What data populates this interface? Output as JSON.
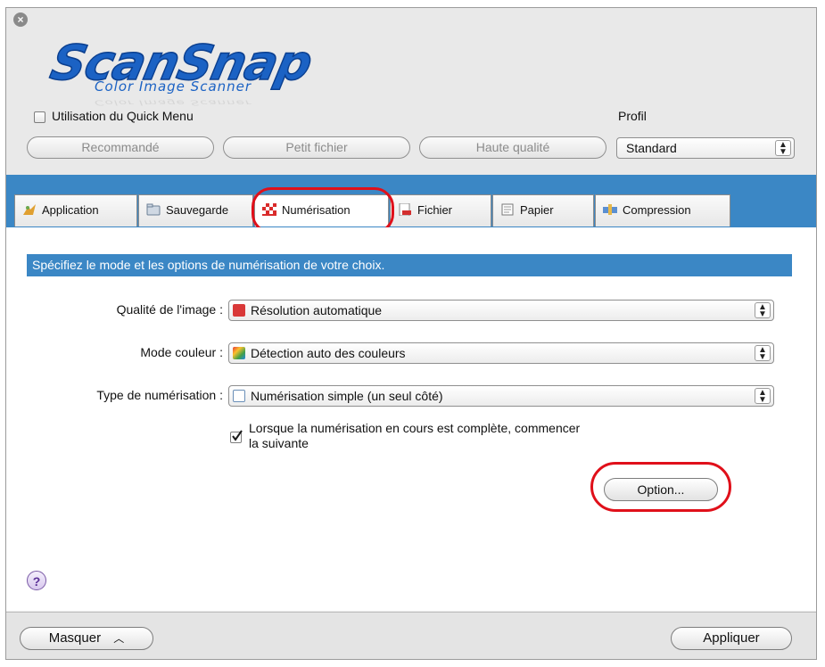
{
  "header": {
    "logo_main": "ScanSnap",
    "logo_sub": "Color Image Scanner"
  },
  "quick_menu": {
    "label": "Utilisation du Quick Menu",
    "checked": false
  },
  "profile_buttons": [
    "Recommandé",
    "Petit fichier",
    "Haute qualité"
  ],
  "profile": {
    "label": "Profil",
    "value": "Standard"
  },
  "tabs": [
    {
      "label": "Application",
      "icon": "application-icon"
    },
    {
      "label": "Sauvegarde",
      "icon": "folder-icon"
    },
    {
      "label": "Numérisation",
      "icon": "scan-icon",
      "selected": true
    },
    {
      "label": "Fichier",
      "icon": "pdf-file-icon"
    },
    {
      "label": "Papier",
      "icon": "paper-icon"
    },
    {
      "label": "Compression",
      "icon": "compression-icon"
    }
  ],
  "scan_panel": {
    "heading": "Spécifiez le mode et les options de numérisation de votre choix.",
    "image_quality": {
      "label": "Qualité de l'image :",
      "value": "Résolution automatique"
    },
    "color_mode": {
      "label": "Mode couleur :",
      "value": "Détection auto des couleurs"
    },
    "scan_type": {
      "label": "Type de numérisation :",
      "value": "Numérisation simple (un seul côté)"
    },
    "continue_scan": {
      "line1": "Lorsque la numérisation en cours est complète, commencer",
      "line2": "la suivante",
      "checked": true
    },
    "option_button": "Option..."
  },
  "footer": {
    "hide_button": "Masquer",
    "apply_button": "Appliquer"
  },
  "colors": {
    "accent": "#3b87c5",
    "highlight_ring": "#e0101a",
    "logo": "#1b62c4"
  }
}
